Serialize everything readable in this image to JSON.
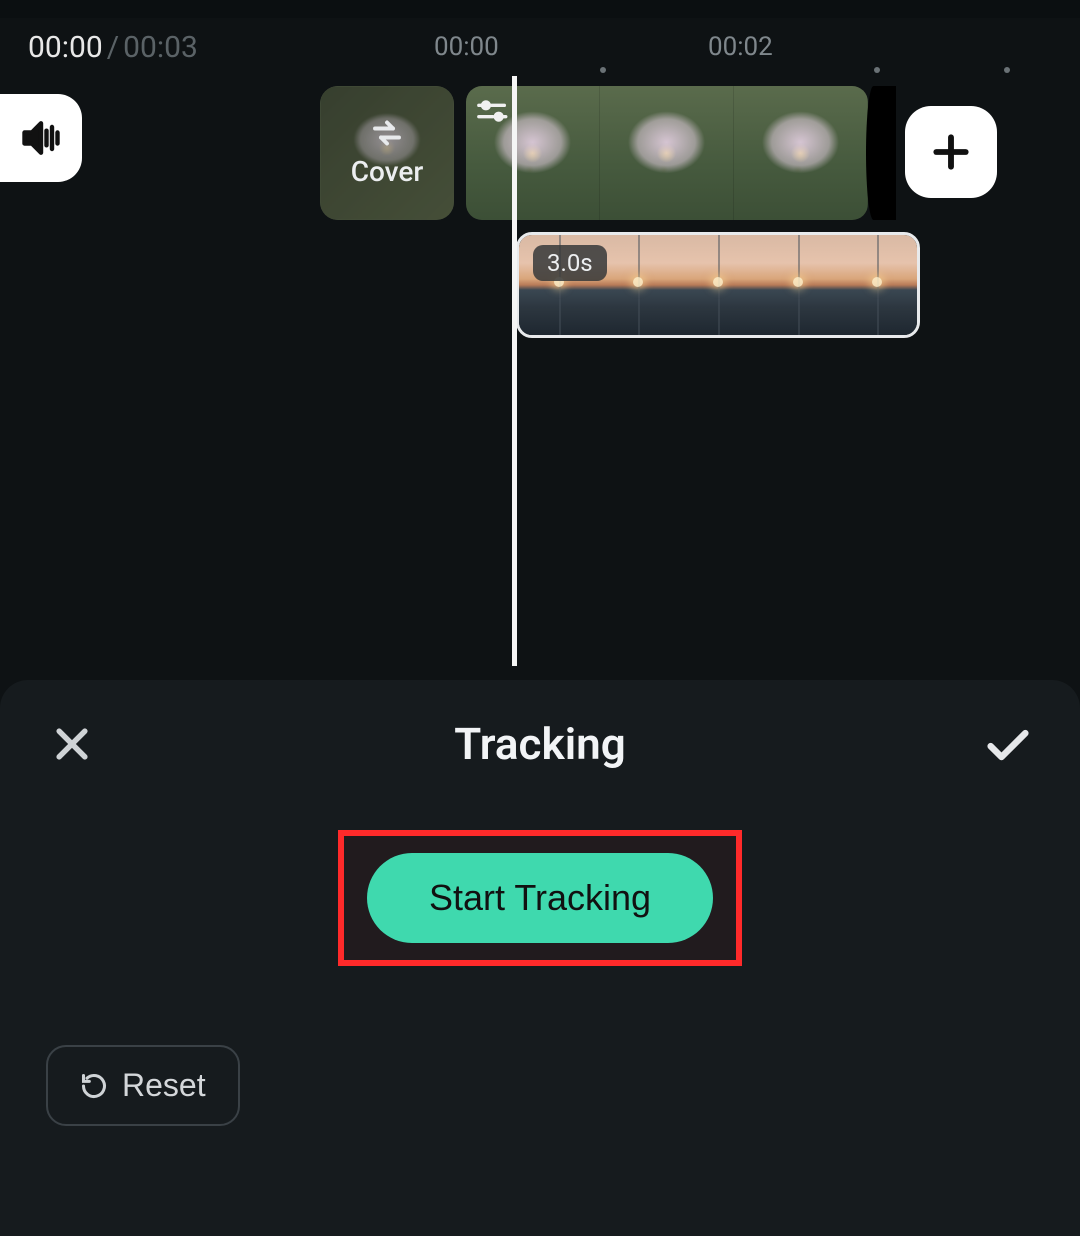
{
  "time": {
    "current": "00:00",
    "separator": " / ",
    "total": "00:03",
    "ruler_mark_1": "00:00",
    "ruler_mark_2": "00:02"
  },
  "icons": {
    "volume": "volume-icon",
    "swap": "swap-icon",
    "settings": "settings-icon",
    "add": "plus-icon",
    "close": "close-icon",
    "confirm": "check-icon",
    "reset": "reset-icon"
  },
  "cover": {
    "label": "Cover"
  },
  "overlay_clip": {
    "duration_label": "3.0s"
  },
  "panel": {
    "title": "Tracking",
    "start_button": "Start Tracking",
    "reset_button": "Reset"
  },
  "colors": {
    "accent": "#3fd9ae",
    "highlight": "#ff2a2a",
    "bg": "#0e1214",
    "panel_bg": "#161b1e"
  }
}
